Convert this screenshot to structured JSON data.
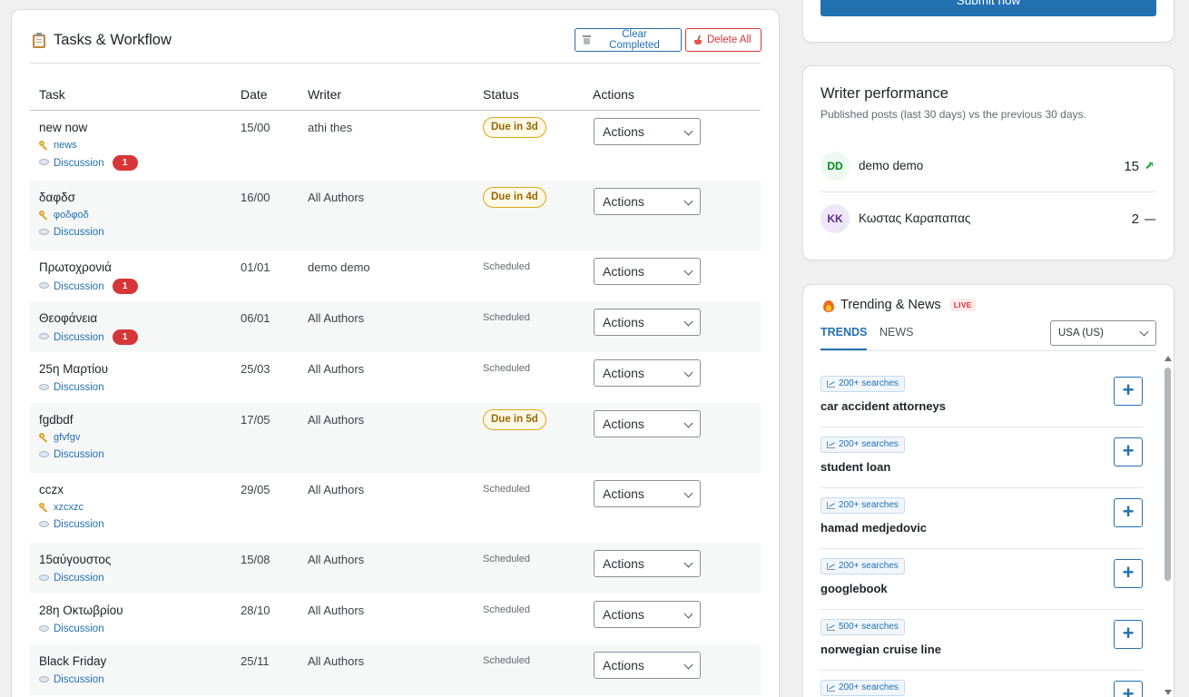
{
  "tasks": {
    "title": "Tasks & Workflow",
    "clear_completed_label": "Clear Completed",
    "delete_all_label": "Delete All",
    "columns": {
      "task": "Task",
      "date": "Date",
      "writer": "Writer",
      "status": "Status",
      "actions": "Actions"
    },
    "rows": [
      {
        "name": "new now",
        "keyword": "news",
        "discussion": "Discussion",
        "comments": "1",
        "date": "15/00",
        "writer": "athi thes",
        "status": "Due in 3d",
        "status_type": "due",
        "action": "Actions"
      },
      {
        "name": "δαφδσ",
        "keyword": "φοδφοδ",
        "discussion": "Discussion",
        "comments": "",
        "date": "16/00",
        "writer": "All Authors",
        "status": "Due in 4d",
        "status_type": "due",
        "action": "Actions"
      },
      {
        "name": "Πρωτοχρονιά",
        "keyword": "",
        "discussion": "Discussion",
        "comments": "1",
        "date": "01/01",
        "writer": "demo demo",
        "status": "Scheduled",
        "status_type": "scheduled",
        "action": "Actions"
      },
      {
        "name": "Θεοφάνεια",
        "keyword": "",
        "discussion": "Discussion",
        "comments": "1",
        "date": "06/01",
        "writer": "All Authors",
        "status": "Scheduled",
        "status_type": "scheduled",
        "action": "Actions"
      },
      {
        "name": "25η Μαρτίου",
        "keyword": "",
        "discussion": "Discussion",
        "comments": "",
        "date": "25/03",
        "writer": "All Authors",
        "status": "Scheduled",
        "status_type": "scheduled",
        "action": "Actions"
      },
      {
        "name": "fgdbdf",
        "keyword": "gfvfgv",
        "discussion": "Discussion",
        "comments": "",
        "date": "17/05",
        "writer": "All Authors",
        "status": "Due in 5d",
        "status_type": "due",
        "action": "Actions"
      },
      {
        "name": "cczx",
        "keyword": "xzcxzc",
        "discussion": "Discussion",
        "comments": "",
        "date": "29/05",
        "writer": "All Authors",
        "status": "Scheduled",
        "status_type": "scheduled",
        "action": "Actions"
      },
      {
        "name": "15αύγουστος",
        "keyword": "",
        "discussion": "Discussion",
        "comments": "",
        "date": "15/08",
        "writer": "All Authors",
        "status": "Scheduled",
        "status_type": "scheduled",
        "action": "Actions"
      },
      {
        "name": "28η Οκτωβρίου",
        "keyword": "",
        "discussion": "Discussion",
        "comments": "",
        "date": "28/10",
        "writer": "All Authors",
        "status": "Scheduled",
        "status_type": "scheduled",
        "action": "Actions"
      },
      {
        "name": "Black Friday",
        "keyword": "",
        "discussion": "Discussion",
        "comments": "",
        "date": "25/11",
        "writer": "All Authors",
        "status": "Scheduled",
        "status_type": "scheduled",
        "action": "Actions"
      }
    ]
  },
  "submit": {
    "label": "Submit now"
  },
  "performance": {
    "title": "Writer performance",
    "subtitle": "Published posts (last 30 days) vs the previous 30 days.",
    "writers": [
      {
        "initials": "DD",
        "name": "demo demo",
        "count": "15",
        "trend": "up"
      },
      {
        "initials": "KK",
        "name": "Κωστας Καραπαπας",
        "count": "2",
        "trend": "flat"
      }
    ]
  },
  "trending": {
    "title": "Trending & News",
    "live_label": "LIVE",
    "tabs": [
      "TRENDS",
      "NEWS"
    ],
    "active_tab": "TRENDS",
    "country": "USA (US)",
    "items": [
      {
        "searches": "200+ searches",
        "term": "car accident attorneys"
      },
      {
        "searches": "200+ searches",
        "term": "student loan"
      },
      {
        "searches": "200+ searches",
        "term": "hamad medjedovic"
      },
      {
        "searches": "200+ searches",
        "term": "googlebook"
      },
      {
        "searches": "500+ searches",
        "term": "norwegian cruise line"
      },
      {
        "searches": "200+ searches",
        "term": ""
      }
    ]
  },
  "colors": {
    "accent": "#2271b1",
    "danger": "#d63638",
    "warning": "#dba617",
    "success": "#00a32a"
  }
}
